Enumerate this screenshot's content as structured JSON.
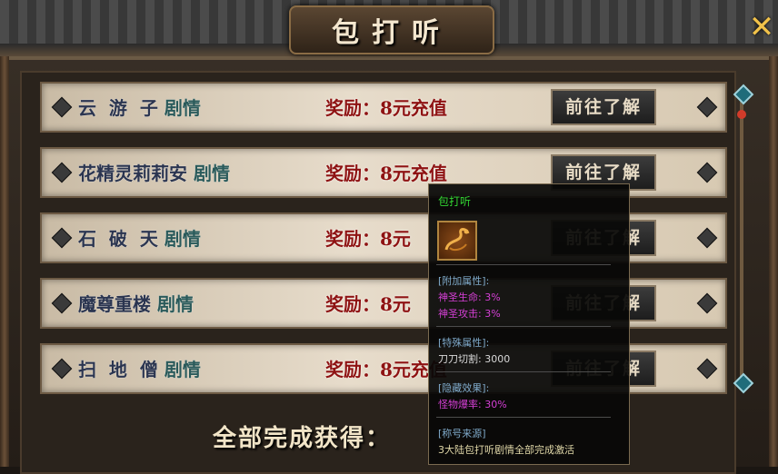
{
  "window": {
    "title": "包打听",
    "close_icon": "close-x-icon"
  },
  "quests": [
    {
      "name": "云  游  子",
      "story": "剧情",
      "reward": "奖励：8元充值",
      "button": "前往了解"
    },
    {
      "name": "花精灵莉莉安",
      "story": "剧情",
      "reward": "奖励：8元充值",
      "button": "前往了解"
    },
    {
      "name": "石  破  天",
      "story": "剧情",
      "reward": "奖励：8元",
      "button": "前往了解"
    },
    {
      "name": "魔尊重楼",
      "story": "剧情",
      "reward": "奖励：8元",
      "button": "前往了解"
    },
    {
      "name": "扫  地  僧",
      "story": "剧情",
      "reward": "奖励：8元充值",
      "button": "前往了解"
    }
  ],
  "footer": {
    "complete_label": "全部完成获得："
  },
  "tooltip": {
    "title": "包打听",
    "icon": "dragon-emblem-icon",
    "attach_header": "[附加属性]:",
    "attach_1": "神圣生命: 3%",
    "attach_2": "神圣攻击: 3%",
    "special_header": "[特殊属性]:",
    "special_1": "刀刀切割: 3000",
    "hidden_header": "[隐藏效果]:",
    "hidden_1": "怪物爆率: 30%",
    "source_header": "[称号来源]",
    "source_1": "3大陆包打听剧情全部完成激活"
  },
  "colors": {
    "reward": "#8e1212",
    "tooltip_title": "#33d633",
    "tooltip_attr": "#d53fd5",
    "tooltip_header": "#7fa9c9"
  }
}
